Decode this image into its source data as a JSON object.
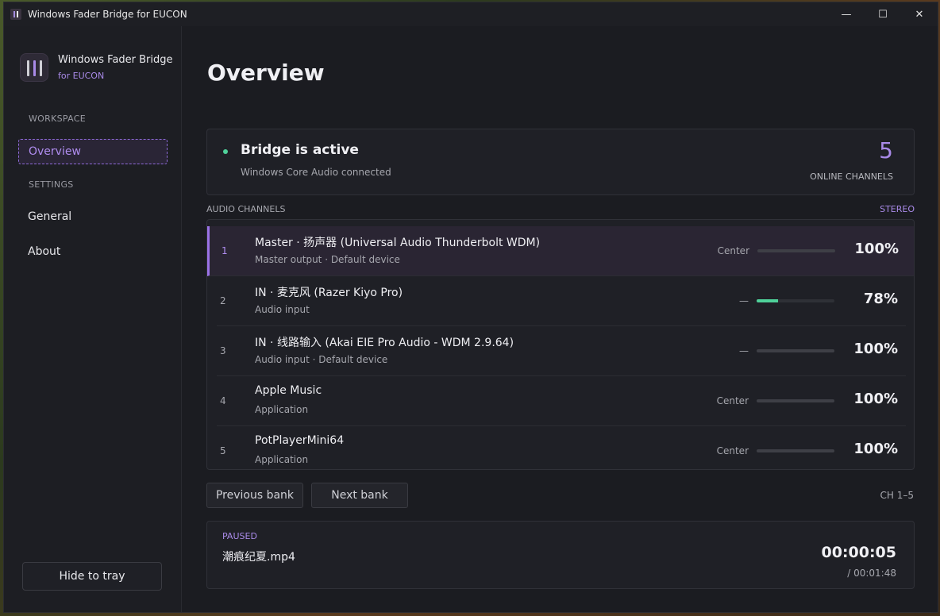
{
  "window": {
    "title": "Windows Fader Bridge for EUCON",
    "controls": {
      "minimize": "—",
      "maximize": "☐",
      "close": "✕"
    }
  },
  "sidebar": {
    "brand_title": "Windows Fader Bridge",
    "brand_sub": "for EUCON",
    "workspace_label": "WORKSPACE",
    "settings_label": "SETTINGS",
    "items": {
      "overview": "Overview",
      "general": "General",
      "about": "About"
    },
    "tray_button": "Hide to tray"
  },
  "main": {
    "title": "Overview",
    "status": {
      "title": "Bridge is active",
      "subtitle": "Windows Core Audio connected",
      "online_count": "5",
      "online_label": "ONLINE CHANNELS"
    },
    "channels_header": "AUDIO CHANNELS",
    "channels_mode": "STEREO",
    "channels": [
      {
        "num": "1",
        "name": "Master · 扬声器 (Universal Audio Thunderbolt WDM)",
        "sub": "Master output  ·  Default device",
        "pan": "Center",
        "level": 1.0,
        "pct": "100%"
      },
      {
        "num": "2",
        "name": "IN · 麦克风 (Razer Kiyo Pro)",
        "sub": "Audio input",
        "pan": "—",
        "level": 0.28,
        "pct": "78%"
      },
      {
        "num": "3",
        "name": "IN · 线路输入 (Akai EIE Pro Audio - WDM 2.9.64)",
        "sub": "Audio input  ·  Default device",
        "pan": "—",
        "level": 1.0,
        "pct": "100%"
      },
      {
        "num": "4",
        "name": "Apple Music",
        "sub": "Application",
        "pan": "Center",
        "level": 1.0,
        "pct": "100%"
      },
      {
        "num": "5",
        "name": "PotPlayerMini64",
        "sub": "Application",
        "pan": "Center",
        "level": 1.0,
        "pct": "100%"
      }
    ],
    "prev_bank": "Previous bank",
    "next_bank": "Next bank",
    "bank_range": "CH 1–5",
    "media": {
      "status": "PAUSED",
      "filename": "潮痕纪夏.mp4",
      "position": "00:00:05",
      "duration": "/ 00:01:48"
    }
  }
}
